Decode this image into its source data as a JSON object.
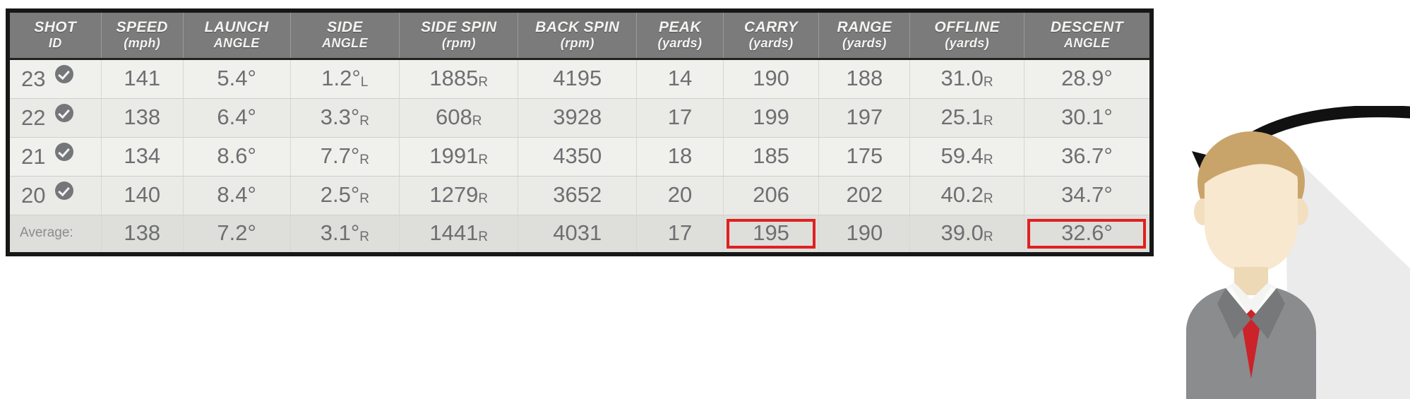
{
  "table": {
    "columns": [
      {
        "name": "SHOT",
        "sub": "ID",
        "unit": ""
      },
      {
        "name": "SPEED",
        "sub": "",
        "unit": "(mph)"
      },
      {
        "name": "LAUNCH",
        "sub": "ANGLE",
        "unit": ""
      },
      {
        "name": "SIDE",
        "sub": "ANGLE",
        "unit": ""
      },
      {
        "name": "SIDE SPIN",
        "sub": "",
        "unit": "(rpm)"
      },
      {
        "name": "BACK SPIN",
        "sub": "",
        "unit": "(rpm)"
      },
      {
        "name": "PEAK",
        "sub": "",
        "unit": "(yards)"
      },
      {
        "name": "CARRY",
        "sub": "",
        "unit": "(yards)"
      },
      {
        "name": "RANGE",
        "sub": "",
        "unit": "(yards)"
      },
      {
        "name": "OFFLINE",
        "sub": "",
        "unit": "(yards)"
      },
      {
        "name": "DESCENT",
        "sub": "ANGLE",
        "unit": ""
      }
    ],
    "headers": {
      "shot_id_l1": "SHOT",
      "shot_id_l2": "ID",
      "speed_l1": "SPEED",
      "speed_l2": "(mph)",
      "launch_l1": "LAUNCH",
      "launch_l2": "ANGLE",
      "side_angle_l1": "SIDE",
      "side_angle_l2": "ANGLE",
      "side_spin_l1": "SIDE SPIN",
      "side_spin_l2": "(rpm)",
      "back_spin_l1": "BACK SPIN",
      "back_spin_l2": "(rpm)",
      "peak_l1": "PEAK",
      "peak_l2": "(yards)",
      "carry_l1": "CARRY",
      "carry_l2": "(yards)",
      "range_l1": "RANGE",
      "range_l2": "(yards)",
      "offline_l1": "OFFLINE",
      "offline_l2": "(yards)",
      "descent_l1": "DESCENT",
      "descent_l2": "ANGLE"
    },
    "rows": [
      {
        "shot_id": "23",
        "selected_icon": "check-circle-icon",
        "speed": "141",
        "launch_angle": "5.4°",
        "side_angle": "1.2°",
        "side_angle_dir": "L",
        "side_spin": "1885",
        "side_spin_dir": "R",
        "back_spin": "4195",
        "peak": "14",
        "carry": "190",
        "range": "188",
        "offline": "31.0",
        "offline_dir": "R",
        "descent_angle": "28.9°"
      },
      {
        "shot_id": "22",
        "selected_icon": "check-circle-icon",
        "speed": "138",
        "launch_angle": "6.4°",
        "side_angle": "3.3°",
        "side_angle_dir": "R",
        "side_spin": "608",
        "side_spin_dir": "R",
        "back_spin": "3928",
        "peak": "17",
        "carry": "199",
        "range": "197",
        "offline": "25.1",
        "offline_dir": "R",
        "descent_angle": "30.1°"
      },
      {
        "shot_id": "21",
        "selected_icon": "check-circle-icon",
        "speed": "134",
        "launch_angle": "8.6°",
        "side_angle": "7.7°",
        "side_angle_dir": "R",
        "side_spin": "1991",
        "side_spin_dir": "R",
        "back_spin": "4350",
        "peak": "18",
        "carry": "185",
        "range": "175",
        "offline": "59.4",
        "offline_dir": "R",
        "descent_angle": "36.7°"
      },
      {
        "shot_id": "20",
        "selected_icon": "check-circle-icon",
        "speed": "140",
        "launch_angle": "8.4°",
        "side_angle": "2.5°",
        "side_angle_dir": "R",
        "side_spin": "1279",
        "side_spin_dir": "R",
        "back_spin": "3652",
        "peak": "20",
        "carry": "206",
        "range": "202",
        "offline": "40.2",
        "offline_dir": "R",
        "descent_angle": "34.7°"
      }
    ],
    "average": {
      "label": "Average:",
      "speed": "138",
      "launch_angle": "7.2°",
      "side_angle": "3.1°",
      "side_angle_dir": "R",
      "side_spin": "1441",
      "side_spin_dir": "R",
      "back_spin": "4031",
      "peak": "17",
      "carry": "195",
      "range": "190",
      "offline": "39.0",
      "offline_dir": "R",
      "descent_angle": "32.6°"
    }
  },
  "highlights": {
    "color": "#e02020",
    "fields": [
      "average.carry",
      "average.descent_angle"
    ]
  },
  "annotation": {
    "arrow_icon": "curved-arrow-icon",
    "avatar_icon": "person-avatar-illustration"
  },
  "colors": {
    "header_bg": "#7b7b7b",
    "row_bg": "#f0f0ed",
    "row_alt_bg": "#eaeae7",
    "average_bg": "#dededa",
    "text": "#6d6f70",
    "frame": "#171717",
    "highlight": "#e02020",
    "tie_red": "#cc2229",
    "suit_grey": "#8a8c8e",
    "skin": "#f3dfc0",
    "hair": "#c9a46a"
  }
}
